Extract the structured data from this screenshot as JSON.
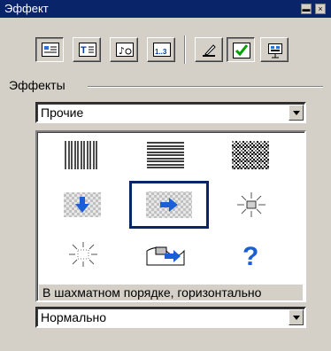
{
  "window": {
    "title": "Эффект",
    "min_glyph": "▬",
    "close_glyph": "×"
  },
  "toolbar": {
    "buttons": [
      {
        "name": "effects-tab-button",
        "icon": "effects-icon",
        "pressed": true
      },
      {
        "name": "text-tab-button",
        "icon": "text-icon",
        "pressed": false
      },
      {
        "name": "sound-tab-button",
        "icon": "sound-icon",
        "pressed": false
      },
      {
        "name": "timing-tab-button",
        "icon": "timing-icon",
        "pressed": false
      },
      {
        "name": "preview-tool-button",
        "icon": "pen-icon",
        "pressed": false
      },
      {
        "name": "apply-button",
        "icon": "check-icon",
        "pressed": true
      },
      {
        "name": "slideshow-button",
        "icon": "slideshow-icon",
        "pressed": false
      }
    ]
  },
  "group": {
    "label": "Эффекты"
  },
  "category_select": {
    "value": "Прочие"
  },
  "effects": {
    "items": [
      {
        "name": "vertical-blinds-effect",
        "icon": "vertical-lines-icon"
      },
      {
        "name": "horizontal-blinds-effect",
        "icon": "horizontal-lines-icon"
      },
      {
        "name": "dissolve-effect",
        "icon": "dissolve-icon"
      },
      {
        "name": "checkerboard-down-effect",
        "icon": "checkerboard-down-icon"
      },
      {
        "name": "checkerboard-right-effect",
        "icon": "checkerboard-right-icon",
        "selected": true
      },
      {
        "name": "fade-center-effect",
        "icon": "sparkle-center-icon"
      },
      {
        "name": "fade-outline-effect",
        "icon": "sparkle-outline-icon"
      },
      {
        "name": "fly-in-effect",
        "icon": "fly-in-icon"
      },
      {
        "name": "random-effect",
        "icon": "question-icon"
      }
    ],
    "caption": "В шахматном порядке, горизонтально"
  },
  "speed_select": {
    "value": "Нормально"
  },
  "colors": {
    "title_bar": "#0a246a",
    "selection": "#0a246a",
    "arrow_blue": "#1a5fd8",
    "check_green": "#00a000"
  }
}
